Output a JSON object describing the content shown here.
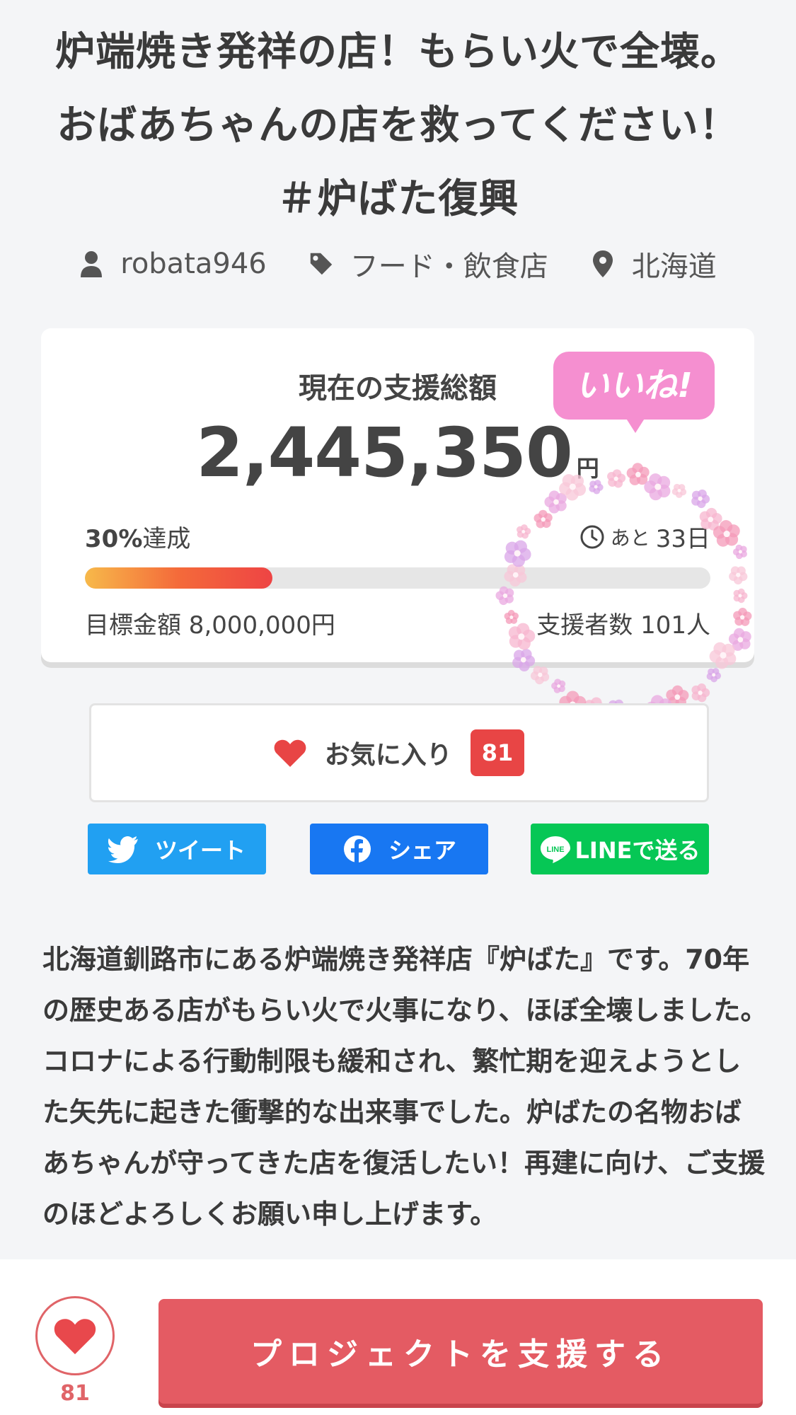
{
  "project": {
    "title": "炉端焼き発祥の店！もらい火で全壊。おばあちゃんの店を救ってください！＃炉ばた復興",
    "owner": "robata946",
    "category": "フード・飲食店",
    "location": "北海道"
  },
  "funding": {
    "label": "現在の支援総額",
    "amount": "2,445,350",
    "unit": "円",
    "achieved_percent": "30%",
    "achieved_suffix": "達成",
    "progress_fraction": 0.3,
    "remaining_prefix": "あと",
    "remaining_days": "33日",
    "goal": "目標金額 8,000,000円",
    "backers": "支援者数 101人"
  },
  "badge": {
    "label": "いいね!"
  },
  "favorite": {
    "label": "お気に入り",
    "count": "81"
  },
  "share": {
    "twitter": "ツイート",
    "facebook": "シェア",
    "line": "LINEで送る"
  },
  "description": "北海道釧路市にある炉端焼き発祥店『炉ばた』です。70年の歴史ある店がもらい火で火事になり、ほぼ全壊しました。コロナによる行動制限も緩和され、繁忙期を迎えようとした矢先に起きた衝撃的な出来事でした。炉ばたの名物おばあちゃんが守ってきた店を復活したい！再建に向け、ご支援のほどよろしくお願い申し上げます。",
  "bottom": {
    "like_count": "81",
    "support_button": "プロジェクトを支援する"
  },
  "colors": {
    "accent": "#e45b63",
    "favorite": "#e84545",
    "twitter": "#21a0f2",
    "facebook": "#1877f2",
    "line": "#06c755",
    "badge": "#f58fd0"
  }
}
